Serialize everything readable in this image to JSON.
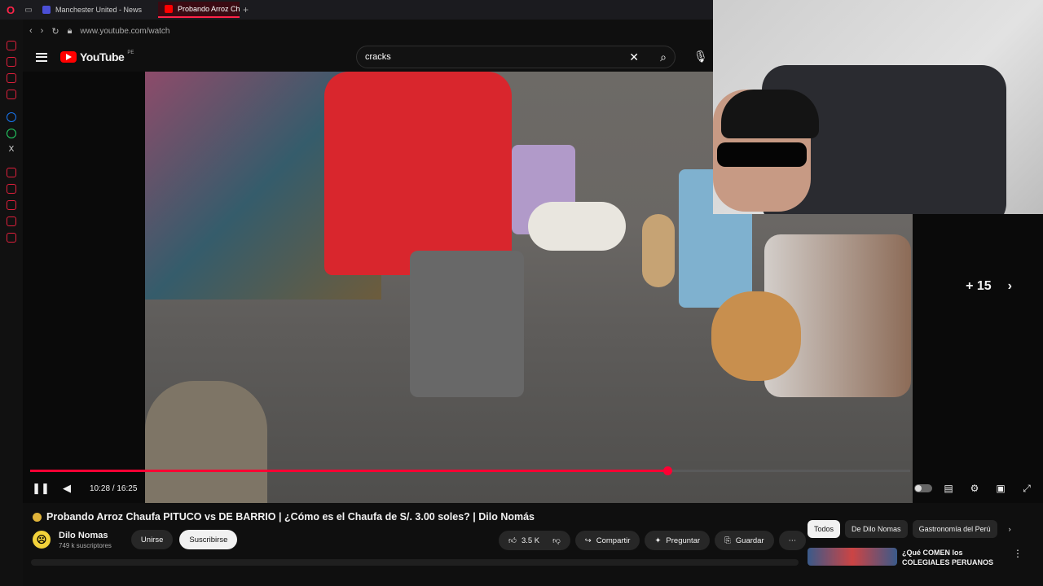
{
  "browser": {
    "tabs": [
      {
        "title": "Manchester United - News"
      },
      {
        "title": "Probando Arroz Chaufa"
      }
    ],
    "url": "www.youtube.com/watch"
  },
  "youtube": {
    "logo_text": "YouTube",
    "country_code": "PE",
    "search_value": "cracks"
  },
  "player": {
    "time": "10:28 / 16:25",
    "progress_fraction": 0.724,
    "endscreen_more": "+ 15"
  },
  "video": {
    "title": "Probando Arroz Chaufa PITUCO vs DE BARRIO | ¿Cómo es el Chaufa de S/. 3.00 soles? | Dilo Nomás",
    "channel": "Dilo Nomas",
    "subscribers": "749 k suscriptores",
    "join_label": "Unirse",
    "subscribe_label": "Suscribirse",
    "likes": "3.5 K",
    "share_label": "Compartir",
    "ask_label": "Preguntar",
    "save_label": "Guardar"
  },
  "chips": [
    "Todos",
    "De Dilo Nomas",
    "Gastronomía del Perú"
  ],
  "recommendation": {
    "title": "¿Qué COMEN los COLEGIALES PERUANOS afue"
  },
  "colors": {
    "accent": "#ff0033",
    "browser_accent": "#ff2449"
  }
}
